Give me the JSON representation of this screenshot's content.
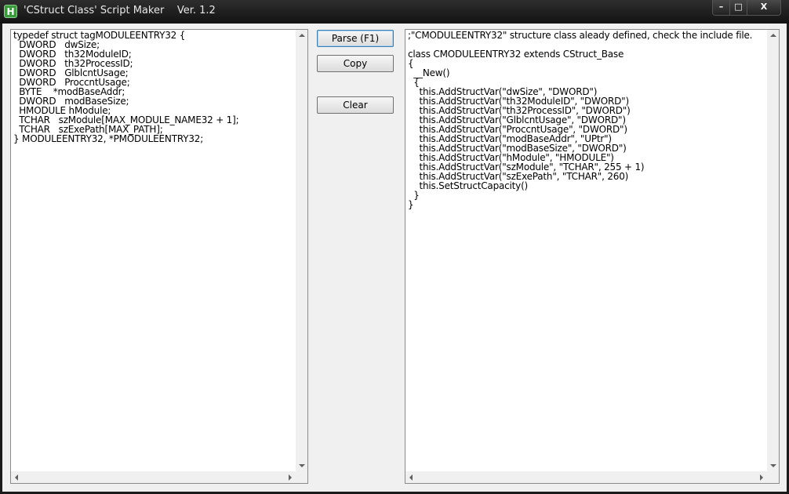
{
  "window": {
    "title": "'CStruct Class' Script Maker    Ver. 1.2",
    "icon_glyph": "H",
    "icon": "app-icon",
    "controls": {
      "minimize": "–",
      "maximize": "□",
      "close": "X"
    }
  },
  "buttons": {
    "parse": "Parse (F1)",
    "copy": "Copy",
    "clear": "Clear"
  },
  "input_text": "typedef struct tagMODULEENTRY32 {\n  DWORD   dwSize;\n  DWORD   th32ModuleID;\n  DWORD   th32ProcessID;\n  DWORD   GlblcntUsage;\n  DWORD   ProccntUsage;\n  BYTE    *modBaseAddr;\n  DWORD   modBaseSize;\n  HMODULE hModule;\n  TCHAR   szModule[MAX_MODULE_NAME32 + 1];\n  TCHAR   szExePath[MAX_PATH];\n} MODULEENTRY32, *PMODULEENTRY32;",
  "output_text": ";\"CMODULEENTRY32\" structure class aleady defined, check the include file.\n\nclass CMODULEENTRY32 extends CStruct_Base\n{\n  __New()\n  {\n    this.AddStructVar(\"dwSize\", \"DWORD\")\n    this.AddStructVar(\"th32ModuleID\", \"DWORD\")\n    this.AddStructVar(\"th32ProcessID\", \"DWORD\")\n    this.AddStructVar(\"GlblcntUsage\", \"DWORD\")\n    this.AddStructVar(\"ProccntUsage\", \"DWORD\")\n    this.AddStructVar(\"modBaseAddr\", \"UPtr\")\n    this.AddStructVar(\"modBaseSize\", \"DWORD\")\n    this.AddStructVar(\"hModule\", \"HMODULE\")\n    this.AddStructVar(\"szModule\", \"TCHAR\", 255 + 1)\n    this.AddStructVar(\"szExePath\", \"TCHAR\", 260)\n    this.SetStructCapacity()\n  }\n}"
}
